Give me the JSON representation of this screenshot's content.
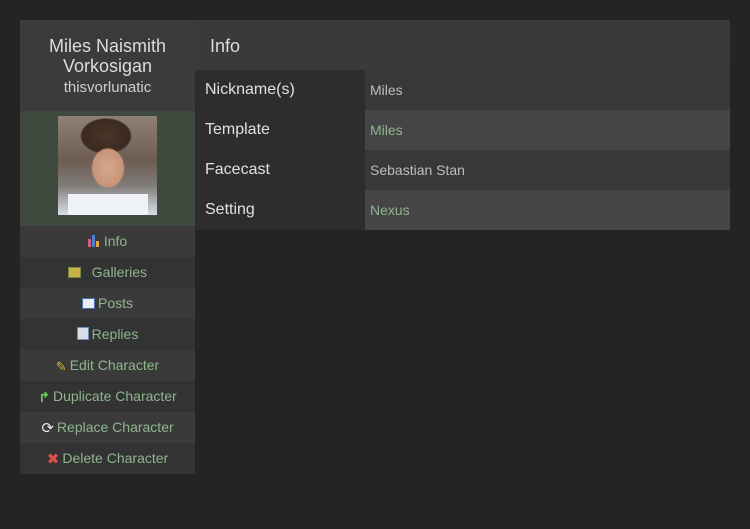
{
  "character": {
    "name": "Miles Naismith Vorkosigan",
    "username": "thisvorlunatic"
  },
  "nav": [
    {
      "label": "Info",
      "icon": "info-icon"
    },
    {
      "label": "Galleries",
      "icon": "galleries-icon"
    },
    {
      "label": "Posts",
      "icon": "posts-icon"
    },
    {
      "label": "Replies",
      "icon": "replies-icon"
    },
    {
      "label": "Edit Character",
      "icon": "pencil-icon"
    },
    {
      "label": "Duplicate Character",
      "icon": "duplicate-arrow-icon"
    },
    {
      "label": "Replace Character",
      "icon": "replace-arrows-icon"
    },
    {
      "label": "Delete Character",
      "icon": "delete-x-icon"
    }
  ],
  "content": {
    "title": "Info",
    "rows": [
      {
        "label": "Nickname(s)",
        "value": "Miles"
      },
      {
        "label": "Template",
        "value": "Miles"
      },
      {
        "label": "Facecast",
        "value": "Sebastian Stan"
      },
      {
        "label": "Setting",
        "value": "Nexus"
      }
    ]
  },
  "colors": {
    "link": "#8fb68f",
    "background": "#242424",
    "panel": "#3a3a3a",
    "delete": "#d9534f"
  }
}
